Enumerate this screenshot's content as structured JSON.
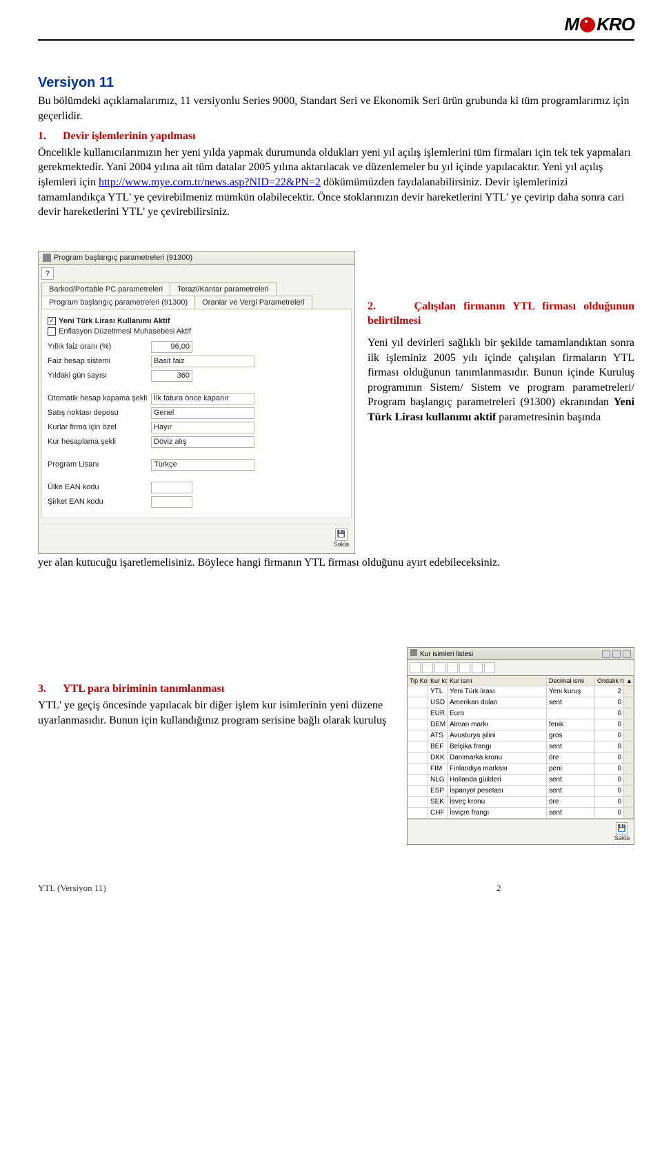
{
  "logo_text": "MiKRO",
  "version_title": "Versiyon 11",
  "intro_para": "Bu bölümdeki açıklamalarımız, 11 versiyonlu Series 9000, Standart Seri ve Ekonomik Seri ürün grubunda ki tüm programlarımız için geçerlidir.",
  "sec1_num": "1.",
  "sec1_title": "Devir işlemlerinin yapılması",
  "sec1_text_a": "Öncelikle kullanıcılarımızın her yeni yılda yapmak durumunda oldukları yeni yıl açılış işlemlerini tüm firmaları için tek tek yapmaları gerekmektedir. Yani 2004 yılına ait tüm datalar 2005 yılına aktarılacak ve düzenlemeler bu yıl içinde yapılacaktır. Yeni yıl açılış işlemleri için ",
  "sec1_link": "http://www.mye.com.tr/news.asp?NID=22&PN=2",
  "sec1_text_b": " dökümümüzden faydalanabilirsiniz. Devir işlemlerinizi tamamlandıkça YTL' ye çevirebilmeniz mümkün olabilecektir. Önce stoklarınızın devir hareketlerini YTL' ye çevirip daha sonra cari devir hareketlerini YTL' ye çevirebilirsiniz.",
  "dialog1": {
    "title": "Program başlangıç parametreleri (91300)",
    "tabs_top": [
      "Barkod/Portable PC parametreleri",
      "Terazi/Kantar parametreleri"
    ],
    "tabs_bot": [
      "Program başlangıç parametreleri (91300)",
      "Oranlar ve Vergi Parametreleri"
    ],
    "chk1": "Yeni Türk Lirası Kullanımı Aktif",
    "chk2": "Enflasyon Düzeltmesi Muhasebesi Aktif",
    "rows": [
      {
        "label": "Yıllık faiz oranı (%)",
        "value": "96,00",
        "type": "num"
      },
      {
        "label": "Faiz hesap sistemi",
        "value": "Basit faiz",
        "type": "sel"
      },
      {
        "label": "Yıldaki gün sayısı",
        "value": "360",
        "type": "num"
      },
      {
        "label": "Otomatik hesap kapama şekli",
        "value": "İlk fatura önce kapanır",
        "type": "sel"
      },
      {
        "label": "Satış noktası deposu",
        "value": "Genel",
        "type": "sel"
      },
      {
        "label": "Kurlar firma için özel",
        "value": "Hayır",
        "type": "sel"
      },
      {
        "label": "Kur hesaplama şekli",
        "value": "Döviz alış",
        "type": "sel"
      },
      {
        "label": "Program Lisanı",
        "value": "Türkçe",
        "type": "sel"
      },
      {
        "label": "Ülke EAN kodu",
        "value": "",
        "type": "num"
      },
      {
        "label": "Şirket EAN kodu",
        "value": "",
        "type": "num"
      }
    ],
    "save": "Sakla"
  },
  "sec2_num": "2.",
  "sec2_title": "Çalışılan firmanın YTL firması olduğunun belirtilmesi",
  "sec2_p_a": "Yeni yıl devirleri sağlıklı bir şekilde tamamlandıktan sonra ilk işleminiz 2005 yılı içinde çalışılan firmaların YTL firması olduğunun tanımlanmasıdır. Bunun içinde Kuruluş programının Sistem/ Sistem ve program parametreleri/ Program başlangıç parametreleri (91300) ekranından ",
  "sec2_bold": "Yeni Türk Lirası kullanımı aktif",
  "sec2_p_b": " parametresinin başında ",
  "sec2_after": "yer alan kutucuğu işaretlemelisiniz. Böylece hangi firmanın YTL firması olduğunu ayırt edebileceksiniz.",
  "sec3_num": "3.",
  "sec3_title": "YTL  para biriminin tanımlanması",
  "sec3_text": "YTL' ye geçiş öncesinde yapılacak bir diğer işlem kur isimlerinin yeni düzene uyarlanmasıdır. Bunun için kullandığınız program serisine bağlı olarak kuruluş",
  "dialog2": {
    "title": "Kur isimleri listesi",
    "head": {
      "tip": "Tip Kodu",
      "kur": "Kur kod",
      "name": "Kur ismi",
      "dec": "Decimal ismi",
      "han": "Ondalık hane"
    },
    "rows": [
      {
        "tip": "",
        "kur": "YTL",
        "name": "Yeni Türk lirası",
        "dec": "Yeni kuruş",
        "han": "2"
      },
      {
        "tip": "",
        "kur": "USD",
        "name": "Amerikan doları",
        "dec": "sent",
        "han": "0"
      },
      {
        "tip": "",
        "kur": "EUR",
        "name": "Euro",
        "dec": "",
        "han": "0"
      },
      {
        "tip": "",
        "kur": "DEM",
        "name": "Alman markı",
        "dec": "fenik",
        "han": "0"
      },
      {
        "tip": "",
        "kur": "ATS",
        "name": "Avusturya şilini",
        "dec": "gros",
        "han": "0"
      },
      {
        "tip": "",
        "kur": "BEF",
        "name": "Belçika frangı",
        "dec": "sent",
        "han": "0"
      },
      {
        "tip": "",
        "kur": "DKK",
        "name": "Danimarka kronu",
        "dec": "öre",
        "han": "0"
      },
      {
        "tip": "",
        "kur": "FIM",
        "name": "Finlandiya markası",
        "dec": "peni",
        "han": "0"
      },
      {
        "tip": "",
        "kur": "NLG",
        "name": "Hollanda güilderi",
        "dec": "sent",
        "han": "0"
      },
      {
        "tip": "",
        "kur": "ESP",
        "name": "İspanyol pesetası",
        "dec": "sent",
        "han": "0"
      },
      {
        "tip": "",
        "kur": "SEK",
        "name": "İsveç kronu",
        "dec": "öre",
        "han": "0"
      },
      {
        "tip": "",
        "kur": "CHF",
        "name": "İsviçre frangı",
        "dec": "sent",
        "han": "0"
      }
    ],
    "save": "Sakla"
  },
  "footer_left": "YTL (Versiyon 11)",
  "footer_page": "2"
}
